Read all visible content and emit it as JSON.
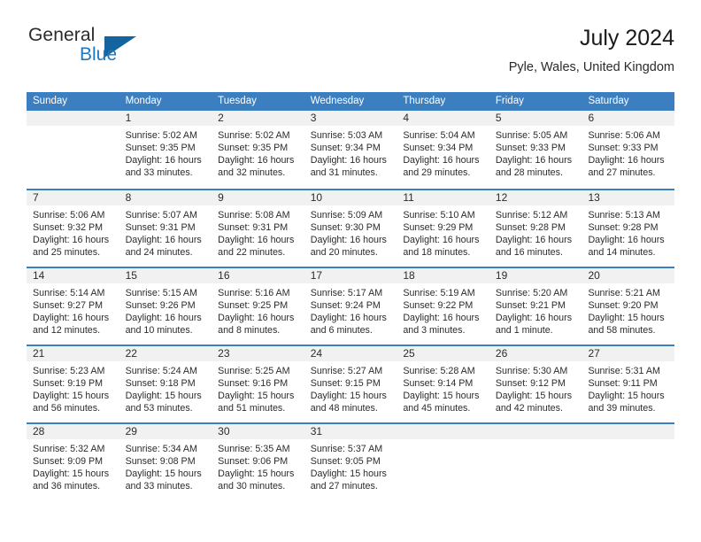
{
  "brand": {
    "name_part1": "General",
    "name_part2": "Blue",
    "logo_icon": "triangle-flag-icon",
    "accent_color": "#14649f"
  },
  "header": {
    "title": "July 2024",
    "location": "Pyle, Wales, United Kingdom"
  },
  "calendar": {
    "header_bg": "#3c7fc0",
    "datenum_bg": "#f1f1f1",
    "weekdays": [
      "Sunday",
      "Monday",
      "Tuesday",
      "Wednesday",
      "Thursday",
      "Friday",
      "Saturday"
    ],
    "weeks": [
      [
        {
          "date": "",
          "empty": true,
          "sunrise": "",
          "sunset": "",
          "daylight": ""
        },
        {
          "date": "1",
          "sunrise": "Sunrise: 5:02 AM",
          "sunset": "Sunset: 9:35 PM",
          "daylight": "Daylight: 16 hours and 33 minutes."
        },
        {
          "date": "2",
          "sunrise": "Sunrise: 5:02 AM",
          "sunset": "Sunset: 9:35 PM",
          "daylight": "Daylight: 16 hours and 32 minutes."
        },
        {
          "date": "3",
          "sunrise": "Sunrise: 5:03 AM",
          "sunset": "Sunset: 9:34 PM",
          "daylight": "Daylight: 16 hours and 31 minutes."
        },
        {
          "date": "4",
          "sunrise": "Sunrise: 5:04 AM",
          "sunset": "Sunset: 9:34 PM",
          "daylight": "Daylight: 16 hours and 29 minutes."
        },
        {
          "date": "5",
          "sunrise": "Sunrise: 5:05 AM",
          "sunset": "Sunset: 9:33 PM",
          "daylight": "Daylight: 16 hours and 28 minutes."
        },
        {
          "date": "6",
          "sunrise": "Sunrise: 5:06 AM",
          "sunset": "Sunset: 9:33 PM",
          "daylight": "Daylight: 16 hours and 27 minutes."
        }
      ],
      [
        {
          "date": "7",
          "sunrise": "Sunrise: 5:06 AM",
          "sunset": "Sunset: 9:32 PM",
          "daylight": "Daylight: 16 hours and 25 minutes."
        },
        {
          "date": "8",
          "sunrise": "Sunrise: 5:07 AM",
          "sunset": "Sunset: 9:31 PM",
          "daylight": "Daylight: 16 hours and 24 minutes."
        },
        {
          "date": "9",
          "sunrise": "Sunrise: 5:08 AM",
          "sunset": "Sunset: 9:31 PM",
          "daylight": "Daylight: 16 hours and 22 minutes."
        },
        {
          "date": "10",
          "sunrise": "Sunrise: 5:09 AM",
          "sunset": "Sunset: 9:30 PM",
          "daylight": "Daylight: 16 hours and 20 minutes."
        },
        {
          "date": "11",
          "sunrise": "Sunrise: 5:10 AM",
          "sunset": "Sunset: 9:29 PM",
          "daylight": "Daylight: 16 hours and 18 minutes."
        },
        {
          "date": "12",
          "sunrise": "Sunrise: 5:12 AM",
          "sunset": "Sunset: 9:28 PM",
          "daylight": "Daylight: 16 hours and 16 minutes."
        },
        {
          "date": "13",
          "sunrise": "Sunrise: 5:13 AM",
          "sunset": "Sunset: 9:28 PM",
          "daylight": "Daylight: 16 hours and 14 minutes."
        }
      ],
      [
        {
          "date": "14",
          "sunrise": "Sunrise: 5:14 AM",
          "sunset": "Sunset: 9:27 PM",
          "daylight": "Daylight: 16 hours and 12 minutes."
        },
        {
          "date": "15",
          "sunrise": "Sunrise: 5:15 AM",
          "sunset": "Sunset: 9:26 PM",
          "daylight": "Daylight: 16 hours and 10 minutes."
        },
        {
          "date": "16",
          "sunrise": "Sunrise: 5:16 AM",
          "sunset": "Sunset: 9:25 PM",
          "daylight": "Daylight: 16 hours and 8 minutes."
        },
        {
          "date": "17",
          "sunrise": "Sunrise: 5:17 AM",
          "sunset": "Sunset: 9:24 PM",
          "daylight": "Daylight: 16 hours and 6 minutes."
        },
        {
          "date": "18",
          "sunrise": "Sunrise: 5:19 AM",
          "sunset": "Sunset: 9:22 PM",
          "daylight": "Daylight: 16 hours and 3 minutes."
        },
        {
          "date": "19",
          "sunrise": "Sunrise: 5:20 AM",
          "sunset": "Sunset: 9:21 PM",
          "daylight": "Daylight: 16 hours and 1 minute."
        },
        {
          "date": "20",
          "sunrise": "Sunrise: 5:21 AM",
          "sunset": "Sunset: 9:20 PM",
          "daylight": "Daylight: 15 hours and 58 minutes."
        }
      ],
      [
        {
          "date": "21",
          "sunrise": "Sunrise: 5:23 AM",
          "sunset": "Sunset: 9:19 PM",
          "daylight": "Daylight: 15 hours and 56 minutes."
        },
        {
          "date": "22",
          "sunrise": "Sunrise: 5:24 AM",
          "sunset": "Sunset: 9:18 PM",
          "daylight": "Daylight: 15 hours and 53 minutes."
        },
        {
          "date": "23",
          "sunrise": "Sunrise: 5:25 AM",
          "sunset": "Sunset: 9:16 PM",
          "daylight": "Daylight: 15 hours and 51 minutes."
        },
        {
          "date": "24",
          "sunrise": "Sunrise: 5:27 AM",
          "sunset": "Sunset: 9:15 PM",
          "daylight": "Daylight: 15 hours and 48 minutes."
        },
        {
          "date": "25",
          "sunrise": "Sunrise: 5:28 AM",
          "sunset": "Sunset: 9:14 PM",
          "daylight": "Daylight: 15 hours and 45 minutes."
        },
        {
          "date": "26",
          "sunrise": "Sunrise: 5:30 AM",
          "sunset": "Sunset: 9:12 PM",
          "daylight": "Daylight: 15 hours and 42 minutes."
        },
        {
          "date": "27",
          "sunrise": "Sunrise: 5:31 AM",
          "sunset": "Sunset: 9:11 PM",
          "daylight": "Daylight: 15 hours and 39 minutes."
        }
      ],
      [
        {
          "date": "28",
          "sunrise": "Sunrise: 5:32 AM",
          "sunset": "Sunset: 9:09 PM",
          "daylight": "Daylight: 15 hours and 36 minutes."
        },
        {
          "date": "29",
          "sunrise": "Sunrise: 5:34 AM",
          "sunset": "Sunset: 9:08 PM",
          "daylight": "Daylight: 15 hours and 33 minutes."
        },
        {
          "date": "30",
          "sunrise": "Sunrise: 5:35 AM",
          "sunset": "Sunset: 9:06 PM",
          "daylight": "Daylight: 15 hours and 30 minutes."
        },
        {
          "date": "31",
          "sunrise": "Sunrise: 5:37 AM",
          "sunset": "Sunset: 9:05 PM",
          "daylight": "Daylight: 15 hours and 27 minutes."
        },
        {
          "date": "",
          "empty": true,
          "sunrise": "",
          "sunset": "",
          "daylight": ""
        },
        {
          "date": "",
          "empty": true,
          "sunrise": "",
          "sunset": "",
          "daylight": ""
        },
        {
          "date": "",
          "empty": true,
          "sunrise": "",
          "sunset": "",
          "daylight": ""
        }
      ]
    ]
  }
}
